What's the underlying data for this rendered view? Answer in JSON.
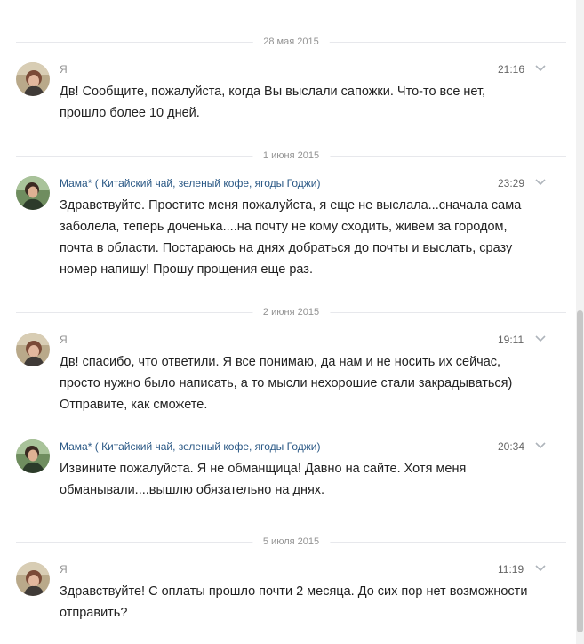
{
  "thread": {
    "date_1": "28 мая 2015",
    "date_2": "1 июня 2015",
    "date_3": "2 июня 2015",
    "date_4": "5 июля 2015",
    "messages": [
      {
        "author": "Я",
        "time": "21:16",
        "lines": [
          "Дв! Сообщите, пожалуйста, когда Вы выслали сапожки. Что-то все нет,",
          "прошло более 10 дней."
        ]
      },
      {
        "author": "Мама* ( Китайский чай, зеленый кофе, ягоды Годжи)",
        "time": "23:29",
        "lines": [
          "Здравствуйте. Простите меня пожалуйста, я еще не выслала...сначала сама",
          "заболела, теперь доченька....на почту не кому сходить, живем за городом,",
          "почта в области. Постараюсь на днях добраться до почты и выслать, сразу",
          "номер напишу! Прошу прощения еще раз."
        ]
      },
      {
        "author": "Я",
        "time": "19:11",
        "lines": [
          "Дв! спасибо, что ответили. Я все понимаю, да нам и не носить их сейчас,",
          "просто нужно было написать, а то мысли нехорошие стали закрадываться)",
          "Отправите, как сможете."
        ]
      },
      {
        "author": "Мама* ( Китайский чай, зеленый кофе, ягоды Годжи)",
        "time": "20:34",
        "lines": [
          "Извините пожалуйста. Я не обманщица! Давно на сайте. Хотя меня",
          "обманывали....вышлю обязательно на днях."
        ]
      },
      {
        "author": "Я",
        "time": "11:19",
        "lines": [
          "Здравствуйте! С оплаты прошло почти 2 месяца. До сих пор нет возможности",
          "отправить?"
        ]
      }
    ]
  },
  "colors": {
    "author_me": "#939393",
    "author_link": "#2a5885",
    "separator": "#e7e8ec"
  },
  "icons": {
    "message_menu": "chevron-down-icon"
  }
}
